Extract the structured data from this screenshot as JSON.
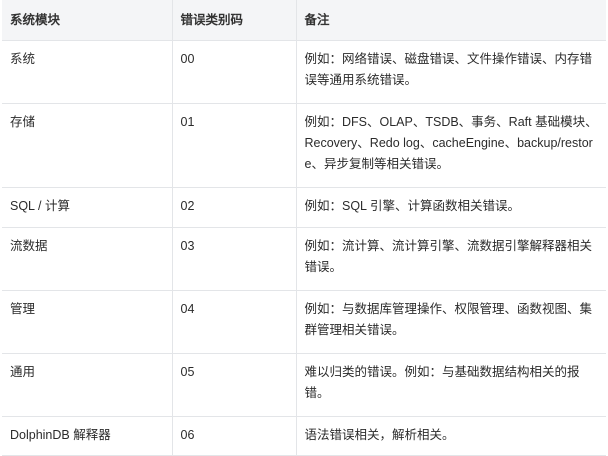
{
  "table": {
    "headers": [
      "系统模块",
      "错误类别码",
      "备注"
    ],
    "rows": [
      {
        "module": "系统",
        "code": "00",
        "note": "例如：网络错误、磁盘错误、文件操作错误、内存错误等通用系统错误。"
      },
      {
        "module": "存储",
        "code": "01",
        "note": "例如：DFS、OLAP、TSDB、事务、Raft 基础模块、Recovery、Redo log、cacheEngine、backup/restore、异步复制等相关错误。"
      },
      {
        "module": "SQL / 计算",
        "code": "02",
        "note": "例如：SQL 引擎、计算函数相关错误。"
      },
      {
        "module": "流数据",
        "code": "03",
        "note": "例如：流计算、流计算引擎、流数据引擎解释器相关错误。"
      },
      {
        "module": "管理",
        "code": "04",
        "note": "例如：与数据库管理操作、权限管理、函数视图、集群管理相关错误。"
      },
      {
        "module": "通用",
        "code": "05",
        "note": "难以归类的错误。例如：与基础数据结构相关的报错。"
      },
      {
        "module": "DolphinDB 解释器",
        "code": "06",
        "note": "语法错误相关，解析相关。"
      }
    ]
  }
}
